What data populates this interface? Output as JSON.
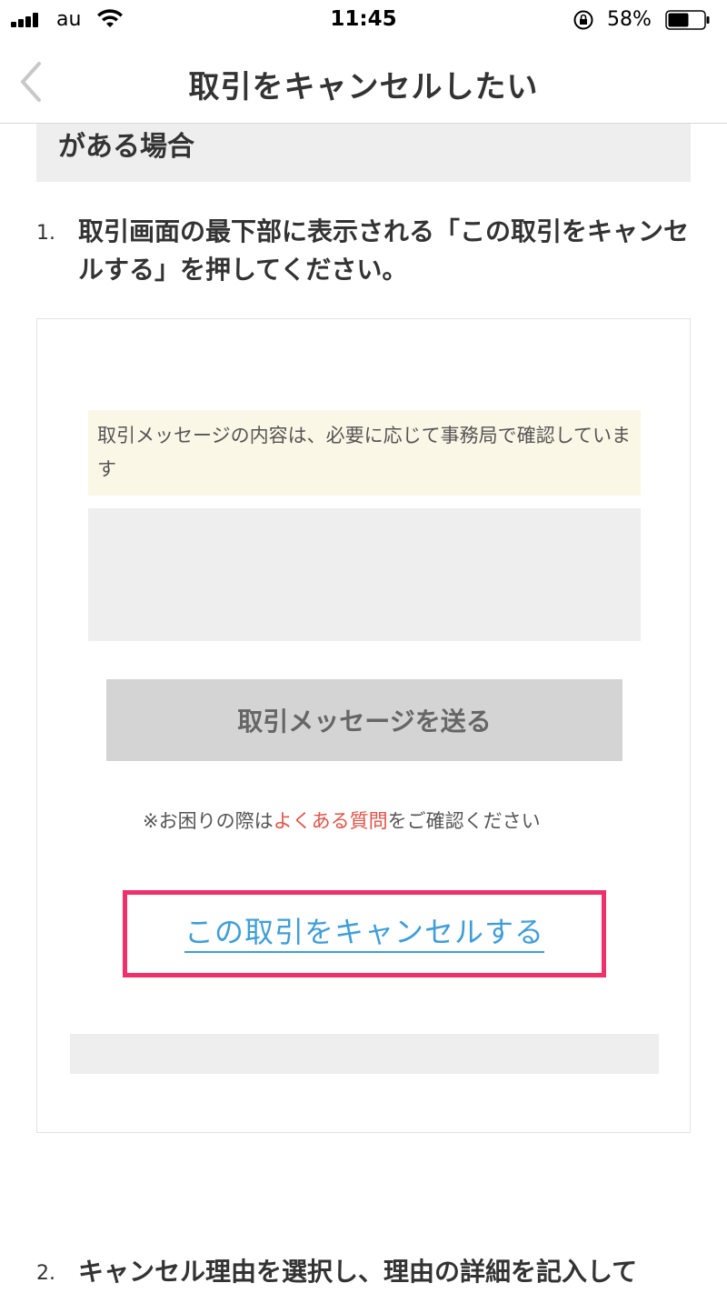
{
  "status_bar": {
    "carrier": "au",
    "time": "11:45",
    "battery_percent": "58%",
    "battery_level": 0.58
  },
  "nav": {
    "title": "取引をキャンセルしたい"
  },
  "section": {
    "title_visible_line": "がある場合"
  },
  "steps": [
    {
      "number": "1.",
      "text": "取引画面の最下部に表示される「この取引をキャンセルする」を押してください。"
    },
    {
      "number": "2.",
      "text": "キャンセル理由を選択し、理由の詳細を記入して"
    }
  ],
  "screenshot": {
    "notice": "取引メッセージの内容は、必要に応じて事務局で確認しています",
    "send_button": "取引メッセージを送る",
    "help_prefix": "※お困りの際は",
    "help_link": "よくある質問",
    "help_suffix": "をご確認ください",
    "cancel_link": "この取引をキャンセルする"
  },
  "colors": {
    "highlight": "#f0306a",
    "link_blue": "#3f9ed8",
    "link_red": "#e05347",
    "notice_bg": "#fbf7e6"
  }
}
